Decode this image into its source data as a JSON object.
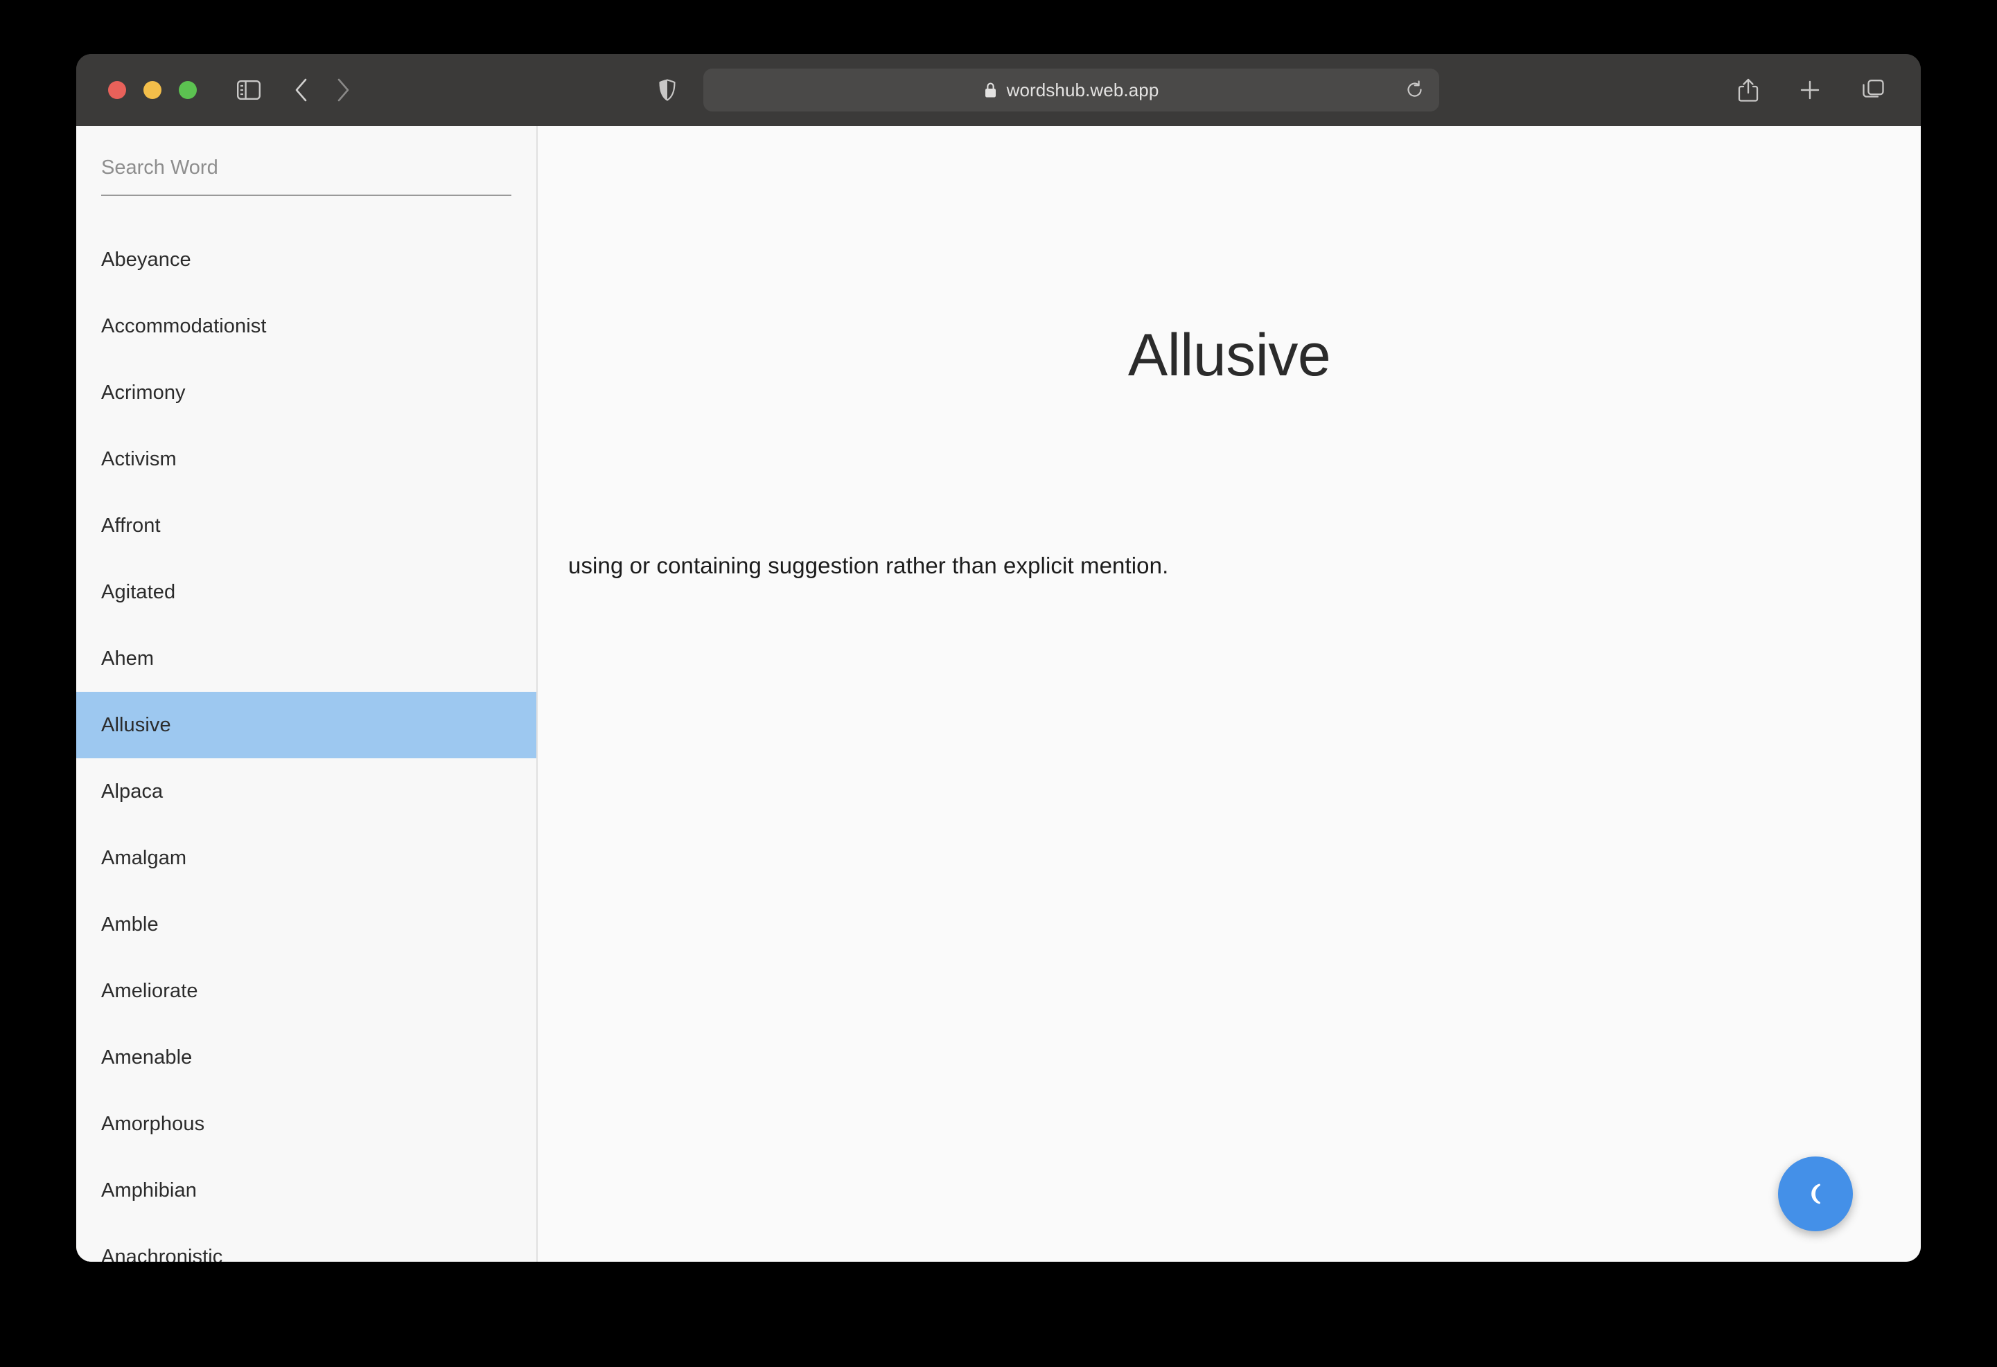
{
  "browser": {
    "url": "wordshub.web.app",
    "lock_icon": "lock-icon",
    "reload_icon": "reload-icon",
    "share_icon": "share-icon",
    "new_tab_icon": "plus-icon",
    "tab_overview_icon": "tab-overview-icon",
    "sidebar_toggle_icon": "sidebar-toggle-icon",
    "back_icon": "chevron-left-icon",
    "forward_icon": "chevron-right-icon",
    "shield_icon": "shield-icon",
    "traffic_lights": {
      "close": "#e8615a",
      "minimize": "#f3be4a",
      "zoom": "#5cc251"
    }
  },
  "sidebar": {
    "search_placeholder": "Search Word",
    "search_value": "",
    "selected_word": "Allusive",
    "words": [
      "Abeyance",
      "Accommodationist",
      "Acrimony",
      "Activism",
      "Affront",
      "Agitated",
      "Ahem",
      "Allusive",
      "Alpaca",
      "Amalgam",
      "Amble",
      "Ameliorate",
      "Amenable",
      "Amorphous",
      "Amphibian",
      "Anachronistic"
    ]
  },
  "content": {
    "word": "Allusive",
    "definition": "using or containing suggestion rather than explicit mention."
  },
  "theme_toggle": {
    "icon": "moon-icon",
    "color": "#4490e8"
  }
}
